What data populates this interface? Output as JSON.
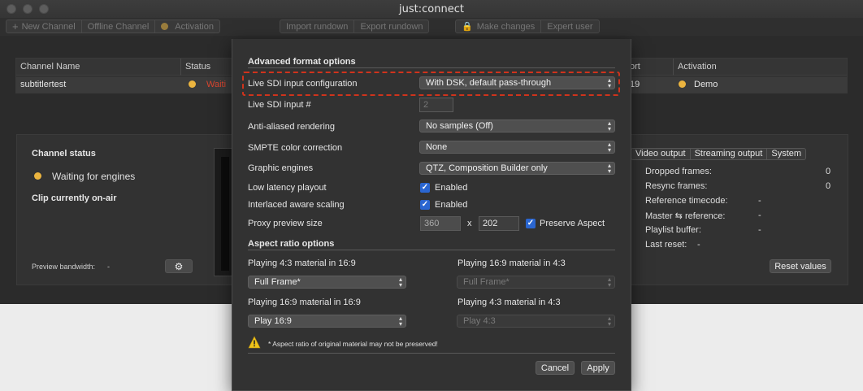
{
  "window": {
    "title": "just:connect",
    "toolbar": {
      "new_channel": "New Channel",
      "offline_channel": "Offline Channel",
      "activation": "Activation",
      "import_rundown": "Import rundown",
      "export_rundown": "Export rundown",
      "make_changes": "Make changes",
      "expert_user": "Expert user"
    }
  },
  "table": {
    "columns": [
      "Channel Name",
      "Status",
      "ort",
      "Activation"
    ],
    "row": {
      "name": "subtitlertest",
      "status": "Waiti",
      "port": "19",
      "activation": "Demo"
    }
  },
  "panel": {
    "channel_status_label": "Channel status",
    "channel_status_value": "Waiting for engines",
    "clip_on_air_label": "Clip currently on-air",
    "preview_bandwidth": "Preview bandwidth:",
    "preview_bandwidth_value": "-",
    "tabs": [
      "Video output",
      "Streaming output",
      "System"
    ],
    "stats": [
      {
        "key": "Dropped frames:",
        "value": "0"
      },
      {
        "key": "Resync frames:",
        "value": "0"
      },
      {
        "key": "Reference timecode:",
        "value": "-"
      },
      {
        "key": "Master ⇆ reference:",
        "value": "-"
      },
      {
        "key": "Playlist buffer:",
        "value": "-"
      },
      {
        "key": "Last reset:",
        "value": "-"
      }
    ],
    "reset_values": "Reset values"
  },
  "dialog": {
    "advanced_title": "Advanced format options",
    "live_sdi_config_label": "Live SDI input configuration",
    "live_sdi_config_value": "With DSK, default pass-through",
    "live_sdi_input_label": "Live SDI input #",
    "live_sdi_input_value": "2",
    "anti_aliased_label": "Anti-aliased rendering",
    "anti_aliased_value": "No samples (Off)",
    "smpte_label": "SMPTE color correction",
    "smpte_value": "None",
    "graphic_engines_label": "Graphic engines",
    "graphic_engines_value": "QTZ, Composition Builder only",
    "low_latency_label": "Low latency playout",
    "low_latency_check": "Enabled",
    "interlaced_label": "Interlaced aware scaling",
    "interlaced_check": "Enabled",
    "proxy_label": "Proxy preview size",
    "proxy_width": "360",
    "proxy_x": "x",
    "proxy_height": "202",
    "preserve_aspect": "Preserve Aspect",
    "aspect_title": "Aspect ratio options",
    "p43_in_169_label": "Playing 4:3 material in 16:9",
    "p43_in_169_value": "Full Frame*",
    "p169_in_43_label": "Playing 16:9 material in 4:3",
    "p169_in_43_value": "Full Frame*",
    "p169_in_169_label": "Playing 16:9 material in 16:9",
    "p169_in_169_value": "Play 16:9",
    "p43_in_43_label": "Playing 4:3 material in 4:3",
    "p43_in_43_value": "Play 4:3",
    "note": "* Aspect ratio of original material may not be preserved!",
    "cancel": "Cancel",
    "apply": "Apply"
  },
  "colors": {
    "accent_blue": "#2a66d1",
    "status_yellow": "#ebb43f",
    "highlight_red": "#d0331c"
  }
}
